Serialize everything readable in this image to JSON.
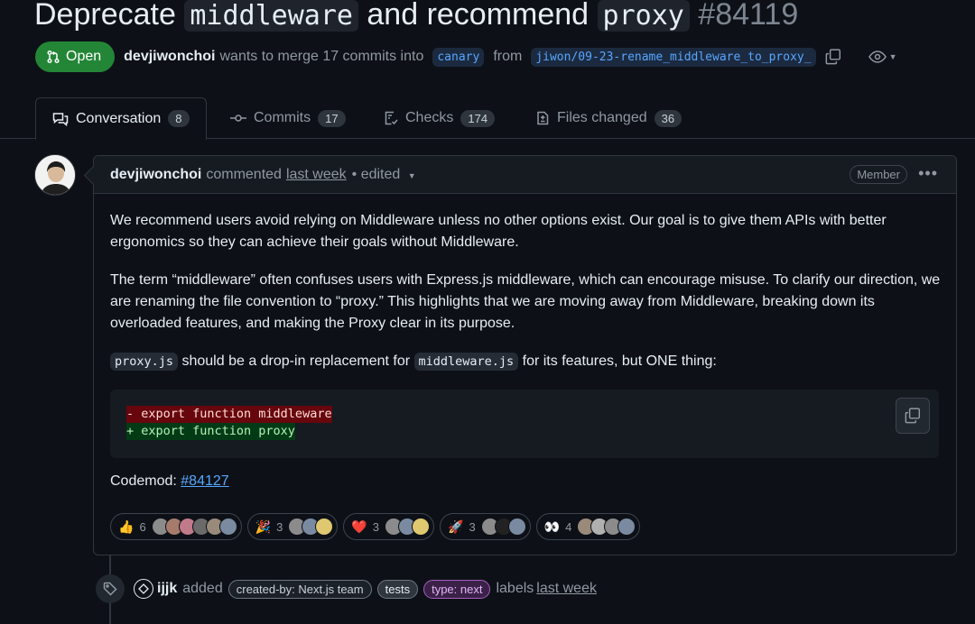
{
  "pr": {
    "title_before": "Deprecate ",
    "title_code1": "middleware",
    "title_mid": " and recommend ",
    "title_code2": "proxy",
    "number": "#84119",
    "state": "Open",
    "author": "devjiwonchoi",
    "merge_text": "wants to merge 17 commits into",
    "base_branch": "canary",
    "from_text": "from",
    "head_branch": "jiwon/09-23-rename_middleware_to_proxy_"
  },
  "tabs": [
    {
      "label": "Conversation",
      "count": "8"
    },
    {
      "label": "Commits",
      "count": "17"
    },
    {
      "label": "Checks",
      "count": "174"
    },
    {
      "label": "Files changed",
      "count": "36"
    }
  ],
  "comment": {
    "author": "devjiwonchoi",
    "action": "commented",
    "time": "last week",
    "edited": "• edited",
    "role_badge": "Member",
    "para1": "We recommend users avoid relying on Middleware unless no other options exist. Our goal is to give them APIs with better ergonomics so they can achieve their goals without Middleware.",
    "para2": "The term “middleware” often confuses users with Express.js middleware, which can encourage misuse. To clarify our direction, we are renaming the file convention to “proxy.” This highlights that we are moving away from Middleware, breaking down its overloaded features, and making the Proxy clear in its purpose.",
    "para3_code1": "proxy.js",
    "para3_mid": " should be a drop-in replacement for ",
    "para3_code2": "middleware.js",
    "para3_end": " for its features, but ONE thing:",
    "code_del": "- export function middleware",
    "code_add": "+ export function proxy",
    "codemod_label": "Codemod: ",
    "codemod_link": "#84127"
  },
  "reactions": [
    {
      "emoji": "👍",
      "count": "6"
    },
    {
      "emoji": "🎉",
      "count": "3"
    },
    {
      "emoji": "❤️",
      "count": "3"
    },
    {
      "emoji": "🚀",
      "count": "3"
    },
    {
      "emoji": "👀",
      "count": "4"
    }
  ],
  "timeline": {
    "actor": "ijjk",
    "action": "added",
    "labels": [
      "created-by: Next.js team",
      "tests",
      "type: next"
    ],
    "suffix": "labels",
    "time": "last week"
  },
  "colors": {
    "open_green": "#238636",
    "link_blue": "#58a6ff",
    "bg": "#0d1117"
  }
}
